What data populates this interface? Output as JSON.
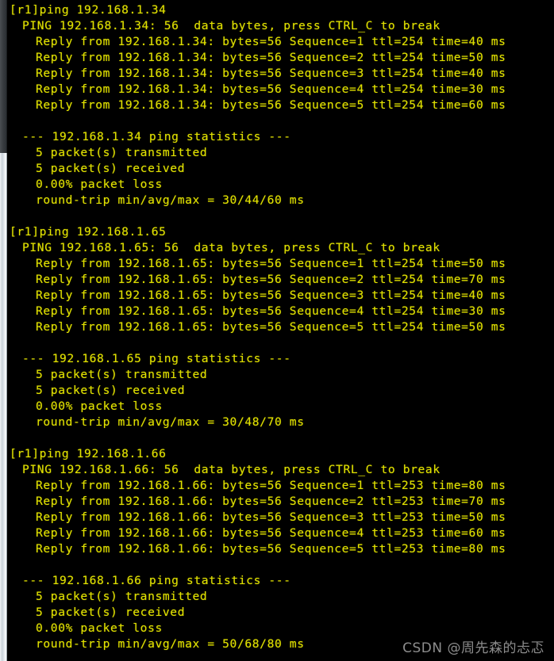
{
  "terminal": {
    "background_color": "#000000",
    "text_color": "#e0e000",
    "watermark": "CSDN @周先森的忐忑",
    "scrollbar": {
      "thumb_color": "#3a3e42",
      "track_color": "#e9eef2"
    }
  },
  "session": {
    "prompt": "[r1]",
    "blocks": [
      {
        "command": "[r1]ping 192.168.1.34",
        "header": "PING 192.168.1.34: 56  data bytes, press CTRL_C to break",
        "replies": [
          "Reply from 192.168.1.34: bytes=56 Sequence=1 ttl=254 time=40 ms",
          "Reply from 192.168.1.34: bytes=56 Sequence=2 ttl=254 time=50 ms",
          "Reply from 192.168.1.34: bytes=56 Sequence=3 ttl=254 time=40 ms",
          "Reply from 192.168.1.34: bytes=56 Sequence=4 ttl=254 time=30 ms",
          "Reply from 192.168.1.34: bytes=56 Sequence=5 ttl=254 time=60 ms"
        ],
        "stats_header": "--- 192.168.1.34 ping statistics ---",
        "stats": [
          "5 packet(s) transmitted",
          "5 packet(s) received",
          "0.00% packet loss",
          "round-trip min/avg/max = 30/44/60 ms"
        ]
      },
      {
        "command": "[r1]ping 192.168.1.65",
        "header": "PING 192.168.1.65: 56  data bytes, press CTRL_C to break",
        "replies": [
          "Reply from 192.168.1.65: bytes=56 Sequence=1 ttl=254 time=50 ms",
          "Reply from 192.168.1.65: bytes=56 Sequence=2 ttl=254 time=70 ms",
          "Reply from 192.168.1.65: bytes=56 Sequence=3 ttl=254 time=40 ms",
          "Reply from 192.168.1.65: bytes=56 Sequence=4 ttl=254 time=30 ms",
          "Reply from 192.168.1.65: bytes=56 Sequence=5 ttl=254 time=50 ms"
        ],
        "stats_header": "--- 192.168.1.65 ping statistics ---",
        "stats": [
          "5 packet(s) transmitted",
          "5 packet(s) received",
          "0.00% packet loss",
          "round-trip min/avg/max = 30/48/70 ms"
        ]
      },
      {
        "command": "[r1]ping 192.168.1.66",
        "header": "PING 192.168.1.66: 56  data bytes, press CTRL_C to break",
        "replies": [
          "Reply from 192.168.1.66: bytes=56 Sequence=1 ttl=253 time=80 ms",
          "Reply from 192.168.1.66: bytes=56 Sequence=2 ttl=253 time=70 ms",
          "Reply from 192.168.1.66: bytes=56 Sequence=3 ttl=253 time=50 ms",
          "Reply from 192.168.1.66: bytes=56 Sequence=4 ttl=253 time=60 ms",
          "Reply from 192.168.1.66: bytes=56 Sequence=5 ttl=253 time=80 ms"
        ],
        "stats_header": "--- 192.168.1.66 ping statistics ---",
        "stats": [
          "5 packet(s) transmitted",
          "5 packet(s) received",
          "0.00% packet loss",
          "round-trip min/avg/max = 50/68/80 ms"
        ]
      }
    ]
  }
}
